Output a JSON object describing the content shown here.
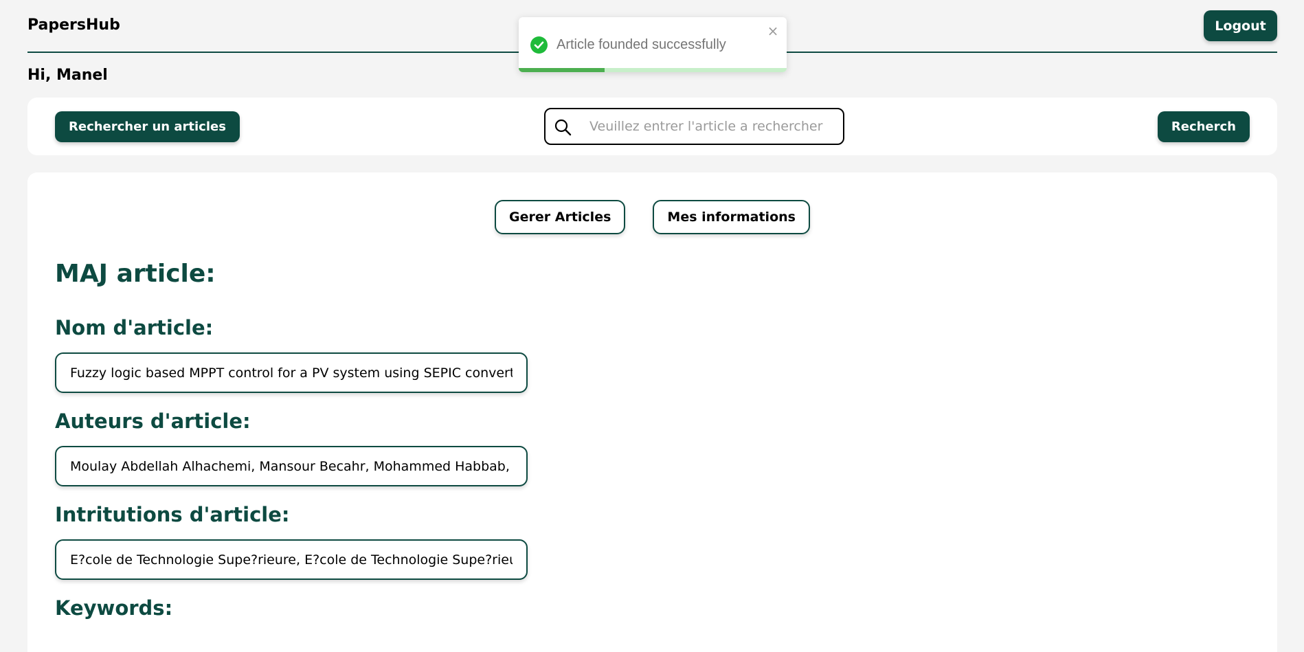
{
  "header": {
    "brand": "PapersHub",
    "logout_label": "Logout"
  },
  "greeting": "Hi, Manel",
  "search": {
    "title_button": "Rechercher un articles",
    "placeholder": "Veuillez entrer l'article a rechercher",
    "go_button": "Recherch"
  },
  "tabs": [
    {
      "label": "Gerer Articles"
    },
    {
      "label": "Mes informations"
    }
  ],
  "form": {
    "title": "MAJ article:",
    "fields": [
      {
        "label": "Nom d'article:",
        "value": "Fuzzy logic based MPPT control for a PV system using SEPIC converter"
      },
      {
        "label": "Auteurs d'article:",
        "value": "Moulay Abdellah Alhachemi, Mansour Becahr, Mohammed Habbab, Hicham"
      },
      {
        "label": "Intritutions d'article:",
        "value": "E?cole de Technologie Supe?rieure, E?cole de Technologie Supe?rieure, Laboratoire"
      },
      {
        "label": "Keywords:"
      }
    ]
  },
  "toast": {
    "message": "Article founded successfully",
    "progress": 0.32,
    "status_color": "#1fbb3a",
    "icon": "check-circle-icon"
  },
  "colors": {
    "primary": "#0d4a41",
    "background": "#f4f4f4"
  }
}
